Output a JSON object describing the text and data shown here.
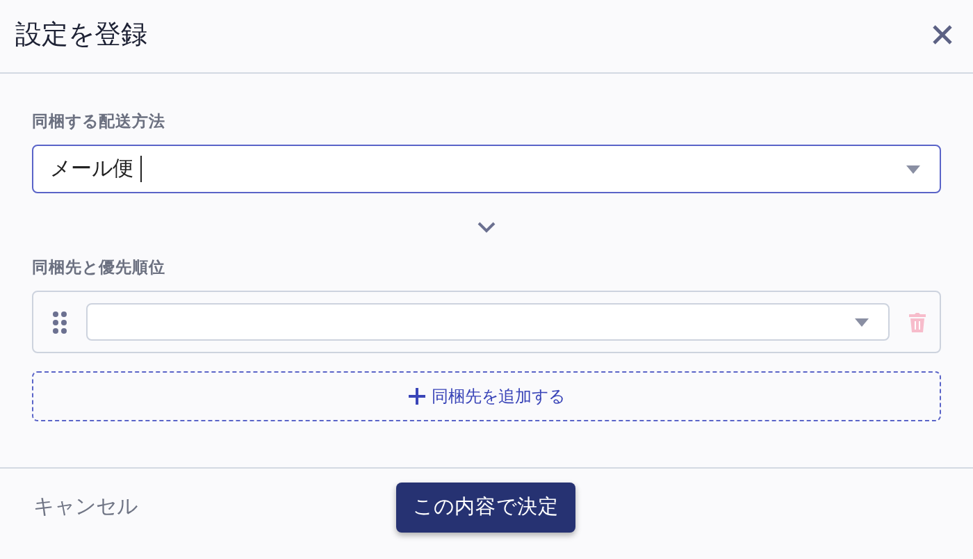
{
  "dialog": {
    "title": "設定を登録"
  },
  "shipping": {
    "label": "同梱する配送方法",
    "value": "メール便",
    "focused": true
  },
  "bundle": {
    "label": "同梱先と優先順位",
    "rows": [
      {
        "value": "",
        "delete_disabled": true
      }
    ],
    "add_label": "同梱先を追加する"
  },
  "footer": {
    "cancel": "キャンセル",
    "submit": "この内容で決定"
  }
}
